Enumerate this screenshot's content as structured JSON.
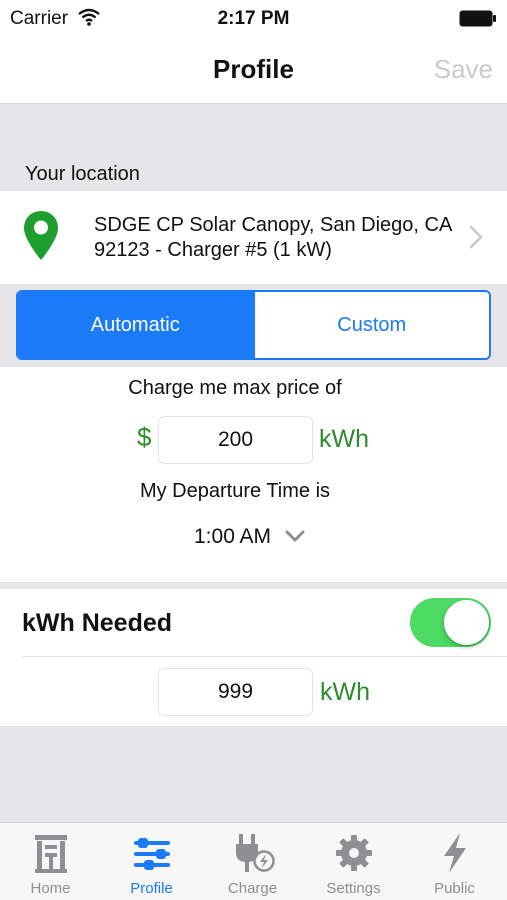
{
  "status_bar": {
    "carrier": "Carrier",
    "time": "2:17 PM"
  },
  "nav": {
    "title": "Profile",
    "save_label": "Save"
  },
  "location": {
    "section_label": "Your location",
    "name": "SDGE CP Solar Canopy, San Diego, CA 92123 - Charger #5 (1 kW)"
  },
  "mode": {
    "options": [
      "Automatic",
      "Custom"
    ],
    "selected": "Automatic"
  },
  "charge": {
    "price_label": "Charge me max price of",
    "currency": "$",
    "price_value": "200",
    "price_unit": "kWh",
    "departure_label": "My Departure Time is",
    "departure_time": "1:00 AM"
  },
  "kwh_needed": {
    "title": "kWh Needed",
    "enabled": true,
    "value": "999",
    "unit": "kWh"
  },
  "tab_bar": {
    "items": [
      {
        "label": "Home",
        "icon": "home-icon"
      },
      {
        "label": "Profile",
        "icon": "sliders-icon"
      },
      {
        "label": "Charge",
        "icon": "plug-icon"
      },
      {
        "label": "Settings",
        "icon": "gear-icon"
      },
      {
        "label": "Public",
        "icon": "lightning-icon"
      }
    ],
    "active": "Profile"
  },
  "colors": {
    "accent": "#1a7af8",
    "green": "#2e8b2e",
    "pin_green": "#1e9e2e",
    "toggle_on": "#4cd964",
    "inactive_tab": "#8e8e93"
  }
}
